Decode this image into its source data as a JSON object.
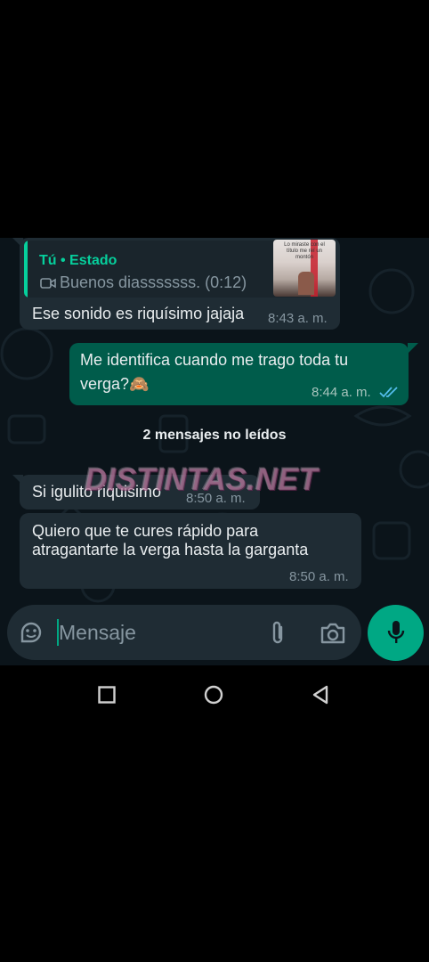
{
  "quoted_status": {
    "author": "Tú • Estado",
    "text": "Buenos diasssssss. (0:12)",
    "thumbnail_caption": "Lo miraste con el título me reí un montón"
  },
  "messages": [
    {
      "direction": "in",
      "text": "Ese sonido es riquísimo jajaja",
      "time": "8:43 a. m."
    },
    {
      "direction": "out",
      "text_line1": "Me identifica cuando me trago toda tu",
      "text_line2": "verga?🙈",
      "time": "8:44 a. m.",
      "status": "read"
    },
    {
      "direction": "in",
      "text": "Si igulito riquisimo",
      "time": "8:50 a. m."
    },
    {
      "direction": "in",
      "text_line1": "Quiero que te cures rápido para",
      "text_line2": "atragantarte la verga hasta la garganta",
      "time": "8:50 a. m."
    }
  ],
  "unread_divider": "2 mensajes no leídos",
  "watermark": "DISTINTAS.NET",
  "composer": {
    "placeholder": "Mensaje"
  },
  "icons": {
    "sticker": "sticker-icon",
    "attach": "paperclip-icon",
    "camera": "camera-icon",
    "mic": "microphone-icon",
    "nav_recents": "square-icon",
    "nav_home": "circle-icon",
    "nav_back": "triangle-back-icon"
  },
  "colors": {
    "chat_bg": "#0b141a",
    "incoming_bubble": "#1f2c34",
    "outgoing_bubble": "#005c4b",
    "accent": "#00a884",
    "read_ticks": "#53bdeb"
  }
}
